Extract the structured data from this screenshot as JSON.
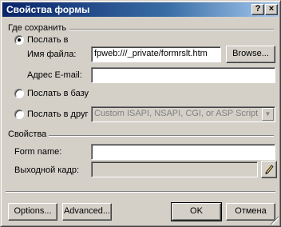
{
  "window": {
    "title": "Свойства формы",
    "help_label": "?",
    "close_label": "×"
  },
  "save_group": {
    "heading": "Где сохранить",
    "send_to_label": "Послать в",
    "file_name_label": "Имя файла:",
    "file_name_value": "fpweb:///_private/formrslt.htm",
    "browse_label": "Browse...",
    "email_label": "Адрес E-mail:",
    "email_value": "",
    "send_to_db_label": "Послать в базу",
    "send_to_other_label": "Послать в друг",
    "other_handler_value": "Custom ISAPI, NSAPI, CGI, or ASP Script",
    "selected_option": "Послать в"
  },
  "props_group": {
    "heading": "Свойства",
    "form_name_label": "Form name:",
    "form_name_value": "",
    "target_frame_label": "Выходной кадр:",
    "target_frame_value": ""
  },
  "footer": {
    "options_label": "Options...",
    "advanced_label": "Advanced...",
    "ok_label": "OK",
    "cancel_label": "Отмена"
  },
  "colors": {
    "face": "#d4d0c8",
    "title_start": "#0a246a",
    "title_end": "#a6caf0"
  },
  "icons": {
    "edit_frame_button": "pencil-icon",
    "combo_arrow": "chevron-down-icon"
  }
}
